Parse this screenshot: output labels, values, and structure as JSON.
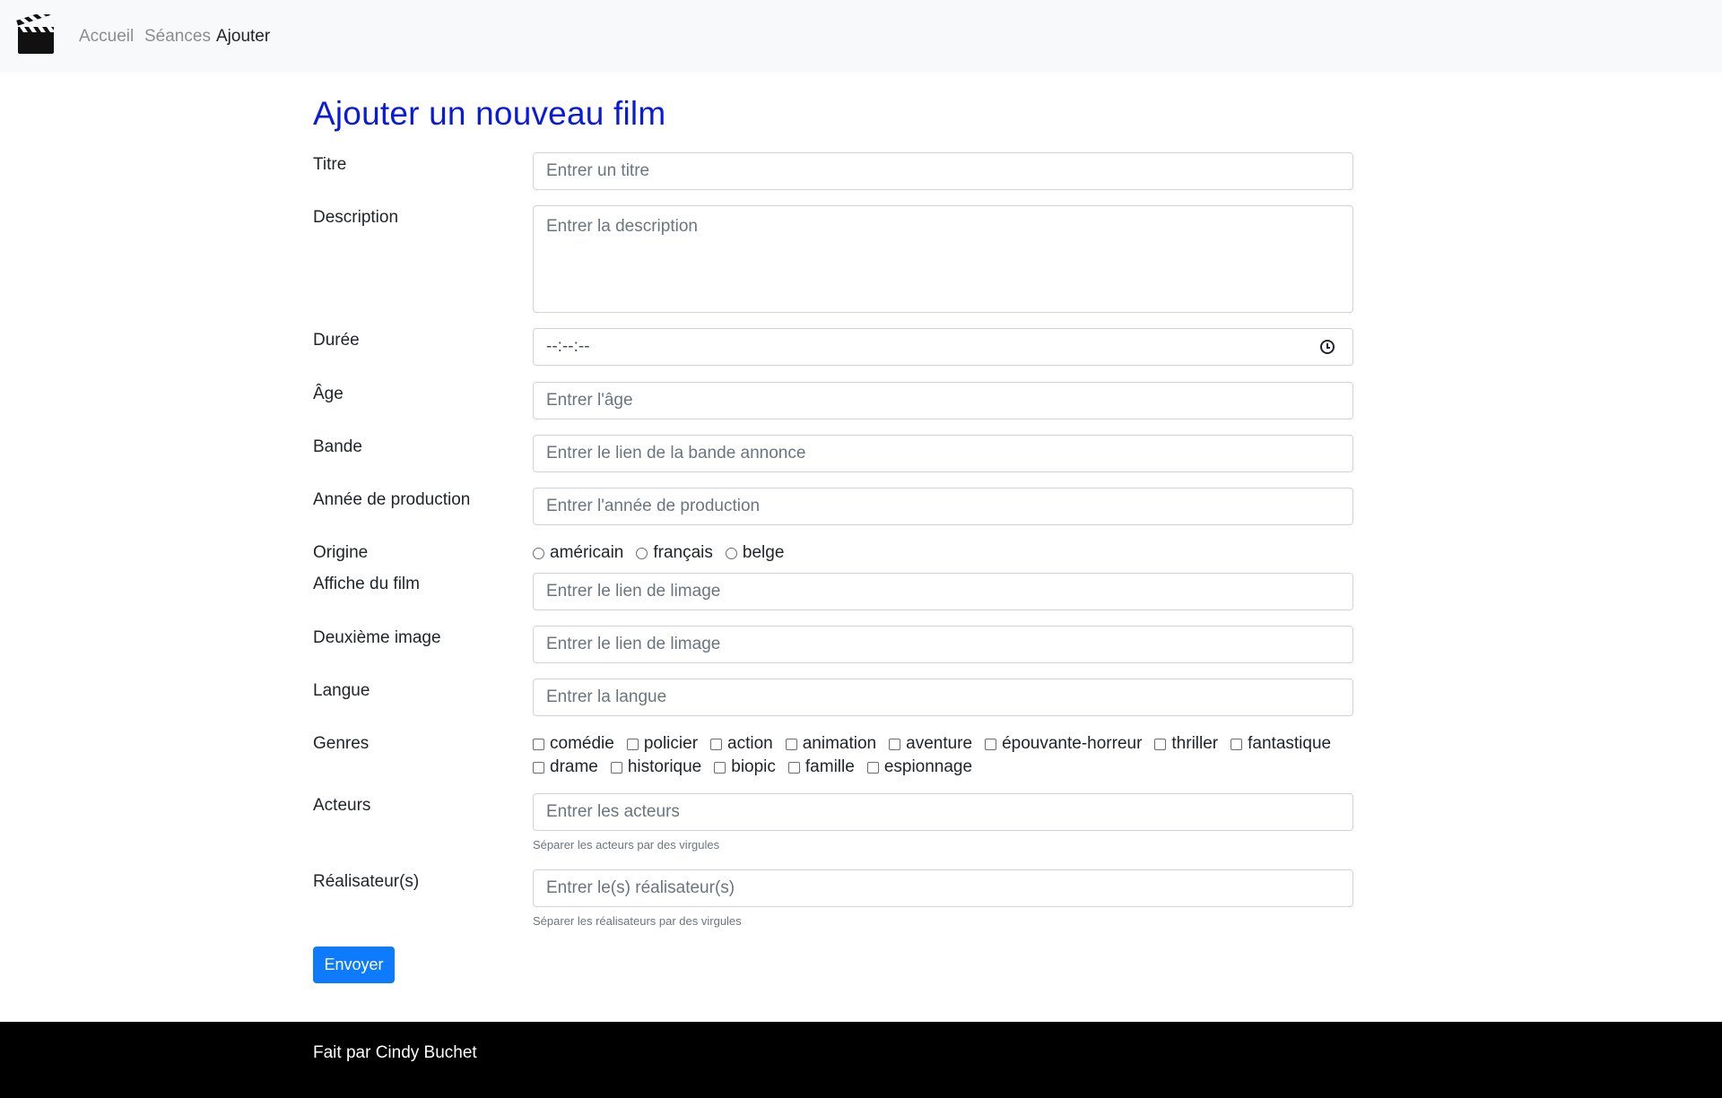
{
  "nav": {
    "logo_icon": "clapperboard-icon",
    "items": [
      {
        "label": "Accueil"
      },
      {
        "label": "Séances"
      },
      {
        "label": "Ajouter"
      }
    ]
  },
  "main": {
    "title": "Ajouter un nouveau film",
    "fields": {
      "titre": {
        "label": "Titre",
        "placeholder": "Entrer un titre"
      },
      "description": {
        "label": "Description",
        "placeholder": "Entrer la description"
      },
      "duree": {
        "label": "Durée",
        "value": "--:--:--"
      },
      "age": {
        "label": "Âge",
        "placeholder": "Entrer l'âge"
      },
      "bande": {
        "label": "Bande",
        "placeholder": "Entrer le lien de la bande annonce"
      },
      "annee": {
        "label": "Année de production",
        "placeholder": "Entrer l'année de production"
      },
      "origine": {
        "label": "Origine",
        "options": [
          "américain",
          "français",
          "belge"
        ]
      },
      "affiche": {
        "label": "Affiche du film",
        "placeholder": "Entrer le lien de limage"
      },
      "deuxieme": {
        "label": "Deuxième image",
        "placeholder": "Entrer le lien de limage"
      },
      "langue": {
        "label": "Langue",
        "placeholder": "Entrer la langue"
      },
      "genres": {
        "label": "Genres",
        "row1": [
          "comédie",
          "policier",
          "action",
          "animation",
          "aventure",
          "épouvante-horreur",
          "thriller",
          "fantastique"
        ],
        "row2": [
          "drame",
          "historique",
          "biopic",
          "famille",
          "espionnage"
        ]
      },
      "acteurs": {
        "label": "Acteurs",
        "placeholder": "Entrer les acteurs",
        "help": "Séparer les acteurs par des virgules"
      },
      "realisateurs": {
        "label": "Réalisateur(s)",
        "placeholder": "Entrer le(s) réalisateur(s)",
        "help": "Séparer les réalisateurs par des virgules"
      }
    },
    "submit_label": "Envoyer"
  },
  "footer": {
    "text": "Fait par Cindy Buchet"
  }
}
